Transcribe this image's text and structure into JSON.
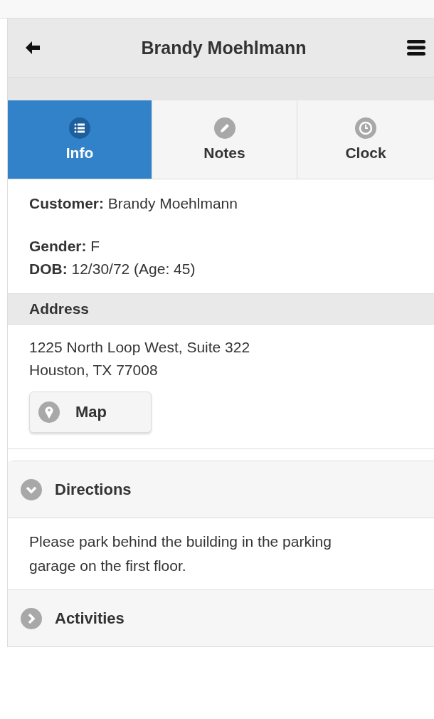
{
  "header": {
    "title": "Brandy Moehlmann"
  },
  "tabs": [
    {
      "label": "Info",
      "kind": "list",
      "selected": true
    },
    {
      "label": "Notes",
      "kind": "pencil",
      "selected": false
    },
    {
      "label": "Clock",
      "kind": "clock",
      "selected": false
    }
  ],
  "customer": {
    "label": "Customer:",
    "value": "Brandy Moehlmann"
  },
  "details": [
    {
      "label": "Gender:",
      "value": "F"
    },
    {
      "label": "DOB:",
      "value": "12/30/72 (Age: 45)"
    }
  ],
  "address": {
    "heading": "Address",
    "lines": [
      "1225 North Loop West, Suite 322",
      "Houston, TX 77008"
    ],
    "button": "Map"
  },
  "sections": [
    {
      "title": "Directions",
      "expanded": true,
      "body": "Please park behind the building in the parking garage on the first floor."
    },
    {
      "title": "Activities",
      "expanded": false
    }
  ]
}
